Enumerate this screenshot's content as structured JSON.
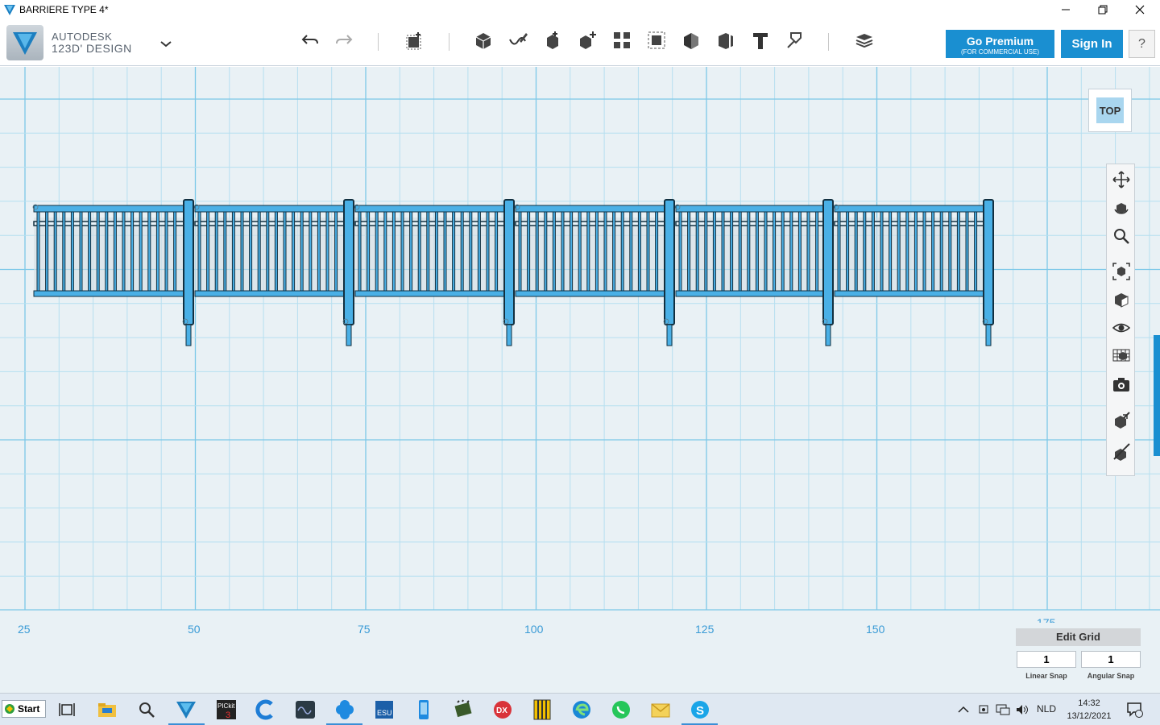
{
  "window": {
    "title": "BARRIERE TYPE 4*"
  },
  "brand": {
    "line1": "AUTODESK",
    "line2": "123D' DESIGN"
  },
  "toolbar": {
    "premium_label": "Go Premium",
    "premium_sub": "(FOR COMMERCIAL USE)",
    "sign_in_label": "Sign In",
    "help_label": "?",
    "icons": [
      "undo-icon",
      "redo-icon",
      "transform-icon",
      "primitives-icon",
      "sketch-icon",
      "construct-icon",
      "modify-icon",
      "pattern-icon",
      "grouping-icon",
      "combine-icon",
      "measure-icon",
      "text-icon",
      "snap-icon",
      "material-icon"
    ]
  },
  "viewcube": {
    "label": "TOP"
  },
  "nav_icons": [
    "pan-icon",
    "orbit-icon",
    "zoom-icon",
    "fit-icon",
    "views-icon",
    "visibility-icon",
    "materials-outlines-icon",
    "screenshot-icon",
    "grid-settings-icon",
    "snap-tool-icon"
  ],
  "grid": {
    "axis_labels": [
      "25",
      "50",
      "75",
      "100",
      "125",
      "150",
      "175"
    ],
    "edit_label": "Edit Grid",
    "linear_snap_value": "1",
    "linear_snap_label": "Linear Snap",
    "angular_snap_value": "1",
    "angular_snap_label": "Angular Snap"
  },
  "taskbar": {
    "start_label": "Start",
    "apps": [
      "task-view-icon",
      "file-explorer-icon",
      "search-icon",
      "123d-design-icon",
      "pickit3-icon",
      "ccleaner-icon",
      "osc-app-icon",
      "blue-app-icon",
      "esu-icon",
      "phone-app-icon",
      "circuit-app-icon",
      "dx-icon",
      "archive-icon",
      "edge-icon",
      "whatsapp-icon",
      "mail-icon",
      "skype-icon"
    ],
    "language": "NLD",
    "time": "14:32",
    "date": "13/12/2021"
  },
  "colors": {
    "accent": "#1a8fd1",
    "model": "#4ab0e6",
    "grid": "#7cc8e8"
  }
}
